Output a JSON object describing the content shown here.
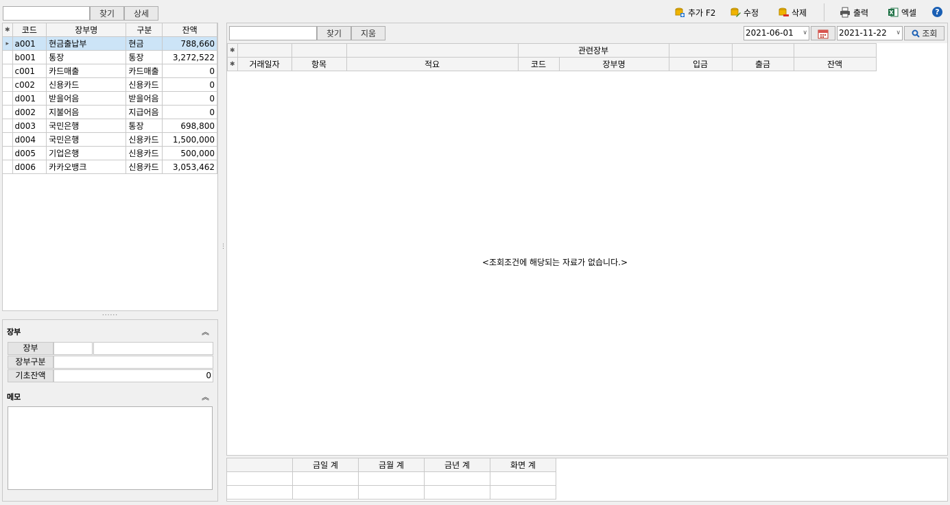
{
  "top_left": {
    "search_value": "",
    "find_label": "찾기",
    "detail_label": "상세"
  },
  "toolbar": {
    "add_label": "추가 F2",
    "edit_label": "수정",
    "delete_label": "삭제",
    "print_label": "출력",
    "excel_label": "엑셀",
    "help_label": "?"
  },
  "account_grid": {
    "headers": {
      "code": "코드",
      "name": "장부명",
      "type": "구분",
      "balance": "잔액"
    },
    "rows": [
      {
        "code": "a001",
        "name": "현금출납부",
        "type": "현금",
        "balance": "788,660"
      },
      {
        "code": "b001",
        "name": "통장",
        "type": "통장",
        "balance": "3,272,522"
      },
      {
        "code": "c001",
        "name": "카드매출",
        "type": "카드매출",
        "balance": "0"
      },
      {
        "code": "c002",
        "name": "신용카드",
        "type": "신용카드",
        "balance": "0"
      },
      {
        "code": "d001",
        "name": "받을어음",
        "type": "받을어음",
        "balance": "0"
      },
      {
        "code": "d002",
        "name": "지불어음",
        "type": "지급어음",
        "balance": "0"
      },
      {
        "code": "d003",
        "name": "국민은행",
        "type": "통장",
        "balance": "698,800"
      },
      {
        "code": "d004",
        "name": "국민은행",
        "type": "신용카드",
        "balance": "1,500,000"
      },
      {
        "code": "d005",
        "name": "기업은행",
        "type": "신용카드",
        "balance": "500,000"
      },
      {
        "code": "d006",
        "name": "카카오뱅크",
        "type": "신용카드",
        "balance": "3,053,462"
      }
    ]
  },
  "splitter_dots": "......",
  "detail": {
    "section_title": "장부",
    "book_label": "장부",
    "book_code": "",
    "book_name": "",
    "type_label": "장부구분",
    "type_value": "",
    "opening_label": "기초잔액",
    "opening_value": "0",
    "memo_title": "메모",
    "memo_value": ""
  },
  "right_search": {
    "search_value": "",
    "find_label": "찾기",
    "clear_label": "지움",
    "date_from": "2021-06-01",
    "date_to": "2021-11-22",
    "query_label": "조회"
  },
  "ledger_grid": {
    "group_header": "관련장부",
    "headers": {
      "date": "거래일자",
      "item": "항목",
      "memo": "적요",
      "code": "코드",
      "name": "장부명",
      "in": "입금",
      "out": "출금",
      "balance": "잔액"
    },
    "empty_message": "<조회조건에 해당되는 자료가 없습니다.>"
  },
  "summary": {
    "headers": [
      "금일 계",
      "금월 계",
      "금년 계",
      "화면 계"
    ]
  },
  "colors": {
    "selected_row": "#cce4f7",
    "help": "#1a5fb4",
    "excel": "#1e7145",
    "accent": "#2b7bd6"
  }
}
